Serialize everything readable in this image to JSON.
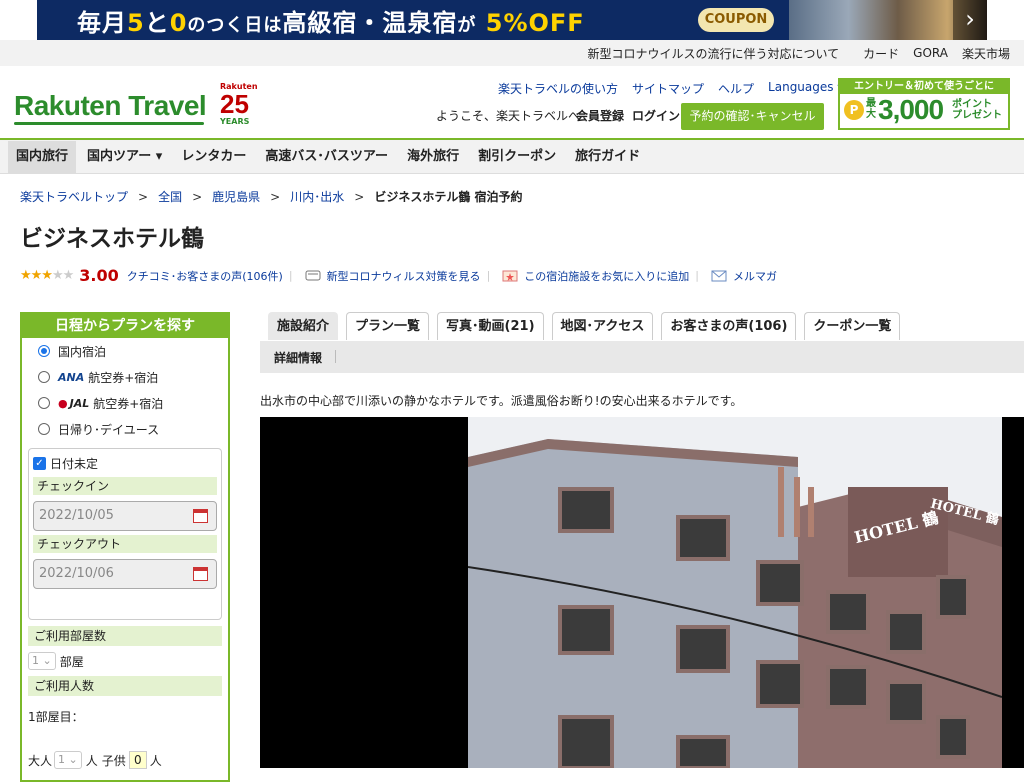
{
  "banner": {
    "text_a": "毎月",
    "text_b": "5",
    "text_c": "と",
    "text_d": "0",
    "text_e": "のつく日は",
    "text_f": "高級宿・温泉宿",
    "text_g": "が",
    "text_h": "5%OFF",
    "coupon": "COUPON",
    "next": "›"
  },
  "toplinks": [
    "新型コロナウイルスの流行に伴う対応について",
    "カード",
    "GORA",
    "楽天市場"
  ],
  "header": {
    "logo": "Rakuten Travel",
    "anniv_brand": "Rakuten",
    "anniv_num": "25",
    "anniv_years": "YEARS",
    "links": [
      "楽天トラベルの使い方",
      "サイトマップ",
      "ヘルプ",
      "Languages"
    ],
    "welcome": "ようこそ、楽天トラベルへ",
    "member": "会員登録",
    "login": "ログイン",
    "reserve": "予約の確認･キャンセル",
    "entry_top": "エントリー＆初めて使うごとに",
    "entry_coin": "P",
    "entry_small": "最大",
    "entry_big": "3,000",
    "entry_pt1": "ポイント",
    "entry_pt2": "プレゼント"
  },
  "nav": [
    "国内旅行",
    "国内ツアー",
    "レンタカー",
    "高速バス･バスツアー",
    "海外旅行",
    "割引クーポン",
    "旅行ガイド"
  ],
  "breadcrumb": [
    "楽天トラベルトップ",
    "全国",
    "鹿児島県",
    "川内･出水",
    "ビジネスホテル鶴 宿泊予約"
  ],
  "title": "ビジネスホテル鶴",
  "rating": {
    "stars": 3,
    "score": "3.00",
    "reviews": "クチコミ･お客さまの声(106件)",
    "covid": "新型コロナウィルス対策を見る",
    "fav": "この宿泊施設をお気に入りに追加",
    "mail": "メルマガ"
  },
  "sidebar": {
    "head": "日程からプランを探す",
    "opt1": "国内宿泊",
    "ana": "ANA",
    "opt2": "航空券+宿泊",
    "jal": "JAL",
    "opt3": "航空券+宿泊",
    "opt4": "日帰り･デイユース",
    "undecided": "日付未定",
    "checkin_label": "チェックイン",
    "checkin": "2022/10/05",
    "checkout_label": "チェックアウト",
    "checkout": "2022/10/06",
    "rooms_label": "ご利用部屋数",
    "rooms": "1",
    "rooms_unit": "部屋",
    "people_label": "ご利用人数",
    "room1": "1部屋目：",
    "adult": "大人",
    "adult_val": "1",
    "person": "人",
    "child": "子供",
    "child_val": "0",
    "person2": "人"
  },
  "tabs": [
    "施設紹介",
    "プラン一覧",
    "写真･動画(21)",
    "地図･アクセス",
    "お客さまの声(106)",
    "クーポン一覧"
  ],
  "subtab": "詳細情報",
  "description": "出水市の中心部で川添いの静かなホテルです。派遣風俗お断り!の安心出来るホテルです。",
  "photo": {
    "sign1": "HOTEL 鶴",
    "sign2": "HOTEL 鶴"
  }
}
